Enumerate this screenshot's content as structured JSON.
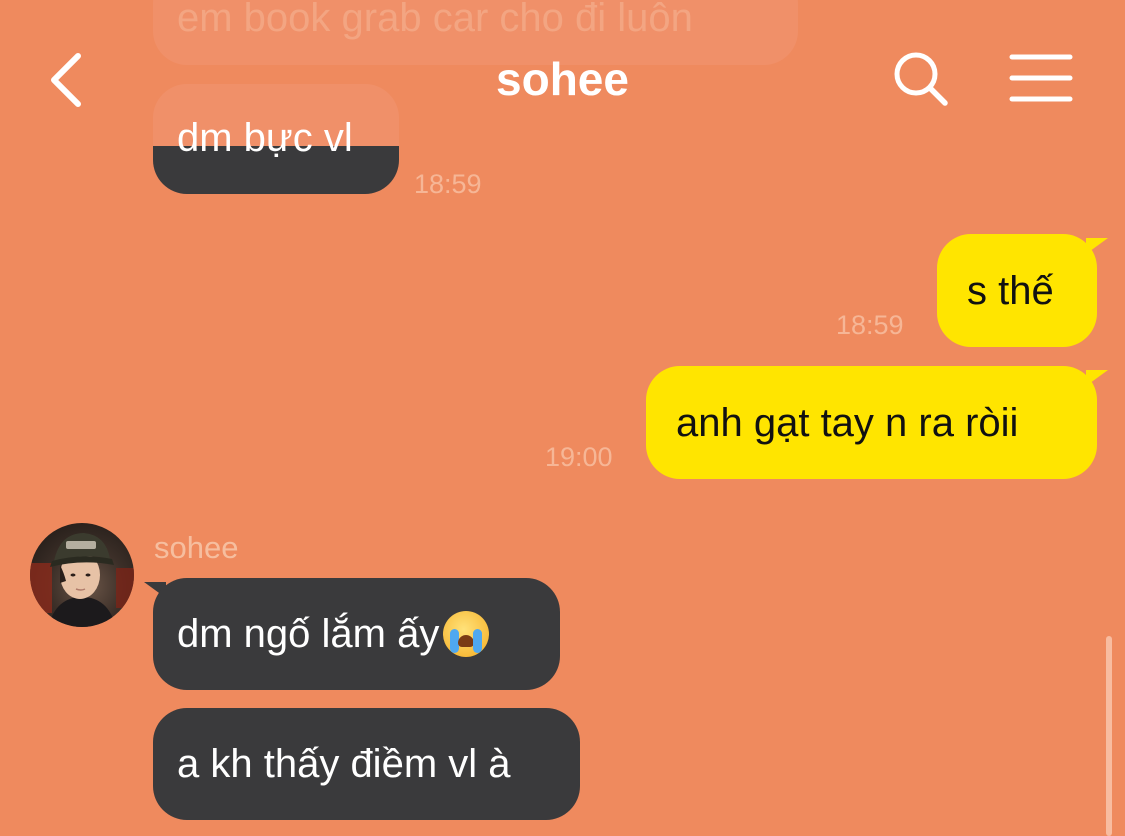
{
  "header": {
    "title": "sohee",
    "back_icon": "chevron-left-icon",
    "search_icon": "search-icon",
    "menu_icon": "menu-icon"
  },
  "messages": [
    {
      "direction": "in",
      "text": "em book grab car cho đi luôn",
      "faded": true
    },
    {
      "direction": "in",
      "text": "dm bực vl",
      "time": "18:59"
    },
    {
      "direction": "out",
      "text": "s thế",
      "time": "18:59"
    },
    {
      "direction": "out",
      "text": "anh gạt tay n ra ròii",
      "time": "19:00"
    },
    {
      "direction": "in",
      "sender": "sohee",
      "text": "dm ngố lắm ấy",
      "emoji": "loudly-crying-face"
    },
    {
      "direction": "in",
      "text": "a kh thấy điềm vl à"
    }
  ],
  "colors": {
    "background": "#EF8A5E",
    "incoming_bubble": "#3A3A3C",
    "outgoing_bubble": "#FFE500",
    "timestamp": "#F6B696"
  }
}
